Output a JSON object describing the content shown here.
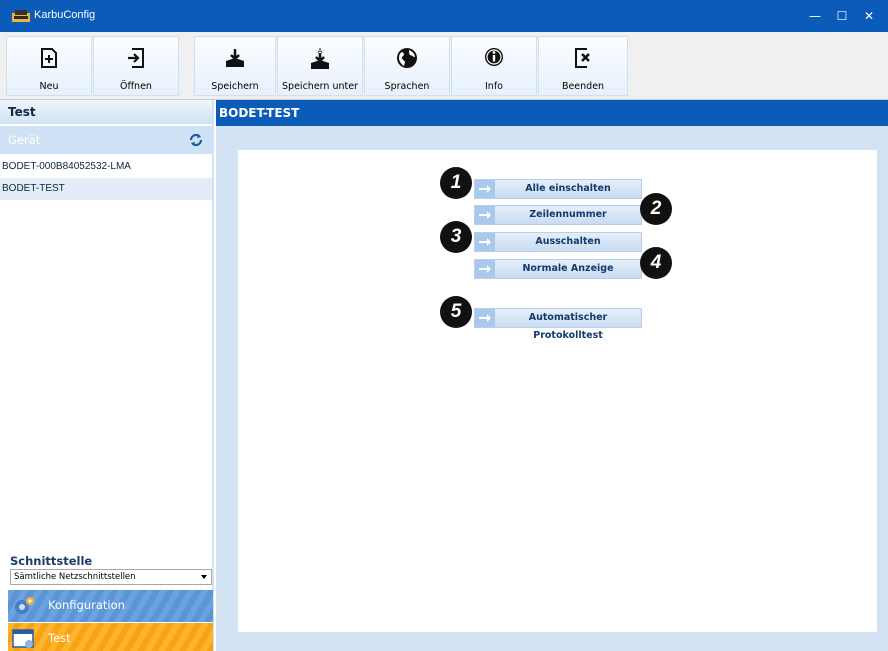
{
  "window": {
    "title": "KarbuConfig",
    "controls": {
      "minimize": "—",
      "maximize": "☐",
      "close": "✕"
    }
  },
  "toolbar": {
    "buttons": [
      {
        "label": "Neu",
        "icon": "new-file-icon"
      },
      {
        "label": "Öffnen",
        "icon": "open-icon"
      },
      {
        "label": "Speichern",
        "icon": "save-icon"
      },
      {
        "label": "Speichern unter",
        "icon": "save-as-icon"
      },
      {
        "label": "Sprachen",
        "icon": "globe-icon"
      },
      {
        "label": "Info",
        "icon": "info-icon"
      },
      {
        "label": "Beenden",
        "icon": "exit-icon"
      }
    ]
  },
  "sidebar": {
    "header": "Test",
    "section_label": "Gerät",
    "devices": [
      "BODET-000B84052532-LMA",
      "BODET-TEST"
    ],
    "selected_device": "BODET-TEST",
    "interface_label": "Schnittstelle",
    "interface_value": "Sämtliche Netzschnittstellen",
    "nav": [
      {
        "label": "Konfiguration",
        "icon": "gears-icon"
      },
      {
        "label": "Test",
        "icon": "test-window-icon"
      }
    ]
  },
  "main": {
    "title": "BODET-TEST",
    "actions": [
      {
        "label": "Alle einschalten",
        "badge": "1"
      },
      {
        "label": "Zeilennummer",
        "badge": "2"
      },
      {
        "label": "Ausschalten",
        "badge": "3"
      },
      {
        "label": "Normale Anzeige",
        "badge": "4"
      },
      {
        "label": "Automatischer Protokolltest",
        "badge": "5"
      }
    ]
  },
  "colors": {
    "title_bar": "#0a5cb8",
    "nav_konfiguration": "#6aa3e0",
    "nav_test": "#ffb42a",
    "action_button": "#c9dcf2"
  }
}
